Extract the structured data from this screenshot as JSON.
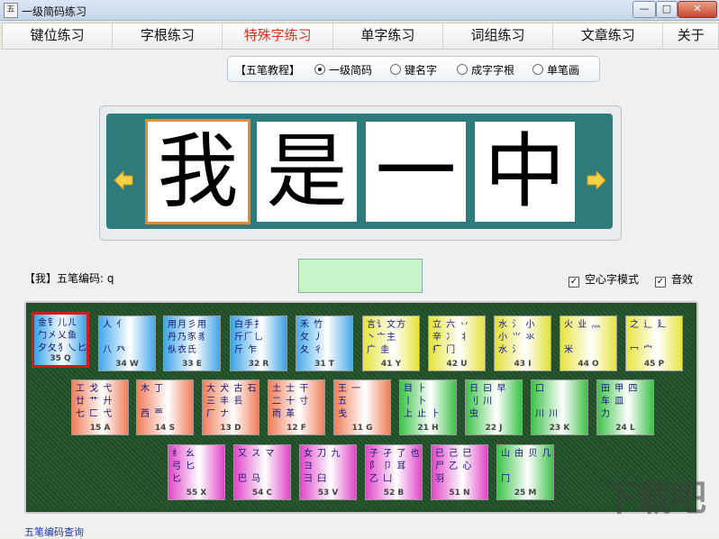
{
  "window": {
    "title": "一级简码练习",
    "icon_text": "五",
    "btn_minimize": "—",
    "btn_maximize": "□",
    "btn_close": "✕"
  },
  "tabs": [
    {
      "label": "键位练习"
    },
    {
      "label": "字根练习"
    },
    {
      "label": "特殊字练习",
      "active": true
    },
    {
      "label": "单字练习"
    },
    {
      "label": "词组练习"
    },
    {
      "label": "文章练习"
    },
    {
      "label": "关于"
    }
  ],
  "tutorial": {
    "label": "【五笔教程】",
    "options": [
      {
        "label": "一级简码",
        "selected": true
      },
      {
        "label": "键名字",
        "selected": false
      },
      {
        "label": "成字字根",
        "selected": false
      },
      {
        "label": "单笔画",
        "selected": false
      }
    ]
  },
  "chars": [
    "我",
    "是",
    "一",
    "中"
  ],
  "code_line": "【我】五笔编码: q",
  "input_value": "",
  "checkboxes": [
    {
      "label": "空心字模式",
      "checked": true
    },
    {
      "label": "音效",
      "checked": true
    }
  ],
  "keys": [
    {
      "rows": [
        "金钅儿ㄦ",
        "勹㐅乂鱼",
        "夕夂犭乀匕"
      ],
      "label": "35 Q",
      "color": "#35a3e8",
      "selected": true
    },
    {
      "rows": [
        "人 亻",
        "",
        "八 癶"
      ],
      "label": "34 W",
      "color": "#43a9ea"
    },
    {
      "rows": [
        "用月彡用",
        "丹乃豕豸",
        "㐺衣氏"
      ],
      "label": "33 E",
      "color": "#3fa5e6"
    },
    {
      "rows": [
        "白手扌",
        "斤𠂆乚",
        "斤 乍"
      ],
      "label": "32 R",
      "color": "#3aa2e4"
    },
    {
      "rows": [
        "禾 竹",
        "攵 丿",
        "夂 彳"
      ],
      "label": "31 T",
      "color": "#48aae8"
    },
    {
      "rows": [
        "言讠文方",
        "丶亠主",
        "广 圭"
      ],
      "label": "41 Y",
      "color": "#e5e33a"
    },
    {
      "rows": [
        "立 六 丷",
        "辛 冫 丬",
        "疒 门"
      ],
      "label": "42 U",
      "color": "#e5e33a"
    },
    {
      "rows": [
        "水 氵 小",
        "小 ⺌ 氺",
        "水 氵"
      ],
      "label": "43 I",
      "color": "#e2e03a"
    },
    {
      "rows": [
        "火 业 灬",
        "",
        "米"
      ],
      "label": "44 O",
      "color": "#e8e440"
    },
    {
      "rows": [
        "之 辶 廴",
        "",
        "冖 宀"
      ],
      "label": "45 P",
      "color": "#e8e440"
    },
    {
      "rows": [
        "工 戈 弋",
        "廿 艹 廾",
        "七 匚 弋"
      ],
      "label": "15 A",
      "color": "#f07e5a"
    },
    {
      "rows": [
        "木 丁",
        "",
        "西 覀"
      ],
      "label": "14 S",
      "color": "#f07e5a"
    },
    {
      "rows": [
        "大 犬 古 石",
        "三 丰 镸",
        "厂 ナ"
      ],
      "label": "13 D",
      "color": "#f07e5a"
    },
    {
      "rows": [
        "土 士 干",
        "二 十 寸",
        "雨 革"
      ],
      "label": "12 F",
      "color": "#f07e5a"
    },
    {
      "rows": [
        "王 一",
        "五",
        "戋"
      ],
      "label": "11 G",
      "color": "#f07e5a"
    },
    {
      "rows": [
        "目 ⺊",
        "丨 卜",
        "上 止 ⺊"
      ],
      "label": "21 H",
      "color": "#3ec24a"
    },
    {
      "rows": [
        "日 曰 早",
        "刂 川",
        "虫"
      ],
      "label": "22 J",
      "color": "#3ec24a"
    },
    {
      "rows": [
        "口",
        "",
        "川 川"
      ],
      "label": "23 K",
      "color": "#3ec24a"
    },
    {
      "rows": [
        "田 甲 四",
        "车 皿",
        "力"
      ],
      "label": "24 L",
      "color": "#3ec24a"
    },
    {
      "rows": [
        "纟 幺",
        "弓 匕",
        "匕"
      ],
      "label": "55 X",
      "color": "#e046c8"
    },
    {
      "rows": [
        "又 ス マ",
        "",
        "巴 马"
      ],
      "label": "54 C",
      "color": "#e046c8"
    },
    {
      "rows": [
        "女 刀 九",
        "ヨ",
        "彐 臼"
      ],
      "label": "53 V",
      "color": "#e046c8"
    },
    {
      "rows": [
        "子 孑 了 也",
        "阝 卩 耳",
        "乙 凵"
      ],
      "label": "52 B",
      "color": "#e046c8"
    },
    {
      "rows": [
        "已 己 巳",
        "尸 乙 心",
        "羽"
      ],
      "label": "51 N",
      "color": "#e046c8"
    },
    {
      "rows": [
        "山 由 贝 几",
        "",
        "冂"
      ],
      "label": "25 M",
      "color": "#3ec24a"
    }
  ],
  "lookup_link": "五笔编码查询",
  "watermark": "下载吧"
}
